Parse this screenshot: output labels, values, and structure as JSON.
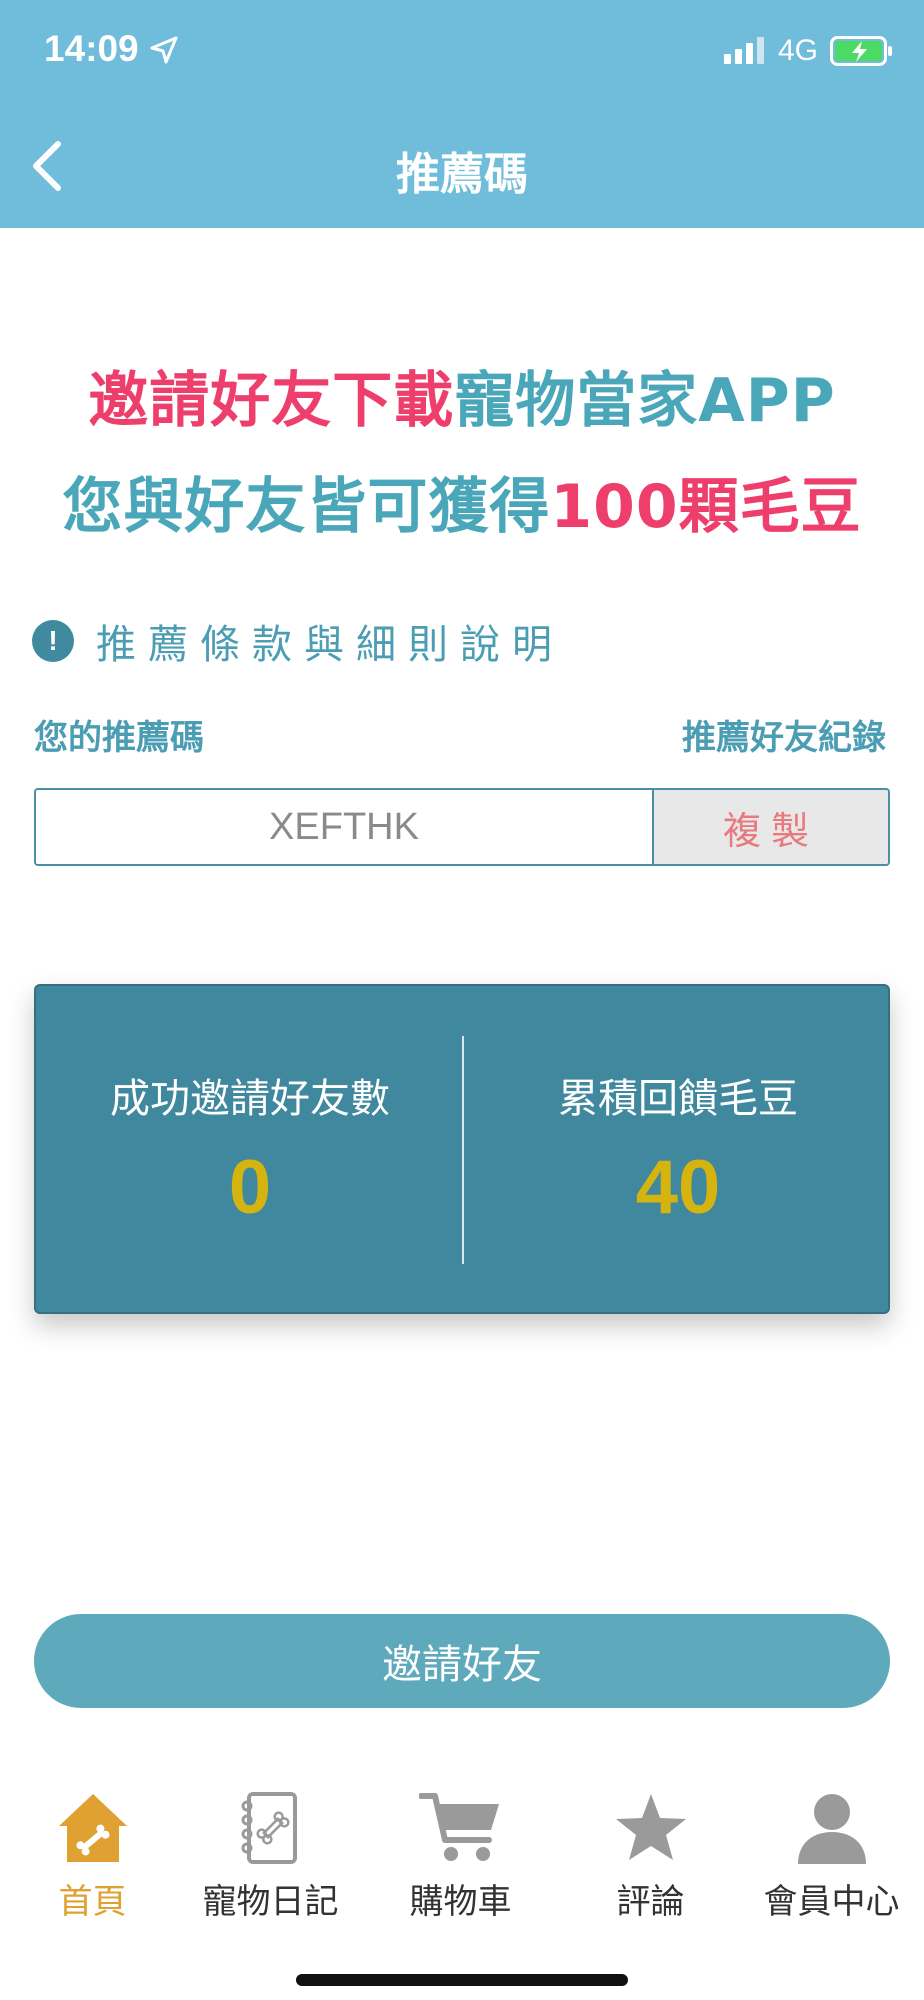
{
  "status_bar": {
    "time": "14:09",
    "network": "4G"
  },
  "header": {
    "title": "推薦碼"
  },
  "banner": {
    "line1_pink": "邀請好友下載",
    "line1_teal": "寵物當家APP",
    "line2_teal": "您與好友皆可獲得",
    "line2_pink": "100顆毛豆"
  },
  "terms": {
    "label": "推薦條款與細則說明"
  },
  "referral": {
    "code_label": "您的推薦碼",
    "history_link": "推薦好友紀錄",
    "code": "XEFTHK",
    "copy_label": "複製"
  },
  "stats": {
    "invited_label": "成功邀請好友數",
    "invited_value": "0",
    "beans_label": "累積回饋毛豆",
    "beans_value": "40"
  },
  "invite_button": "邀請好友",
  "bottom_nav": {
    "items": [
      {
        "label": "首頁",
        "icon": "home-bone-icon",
        "active": true
      },
      {
        "label": "寵物日記",
        "icon": "diary-icon",
        "active": false
      },
      {
        "label": "購物車",
        "icon": "cart-icon",
        "active": false
      },
      {
        "label": "評論",
        "icon": "star-icon",
        "active": false
      },
      {
        "label": "會員中心",
        "icon": "user-icon",
        "active": false
      }
    ]
  },
  "colors": {
    "header_bg": "#6fbcdb",
    "pink": "#ee3f6c",
    "teal": "#4aa6b9",
    "card_bg": "#3f889e",
    "stat_value": "#d6b410",
    "active_nav": "#e0a133"
  }
}
